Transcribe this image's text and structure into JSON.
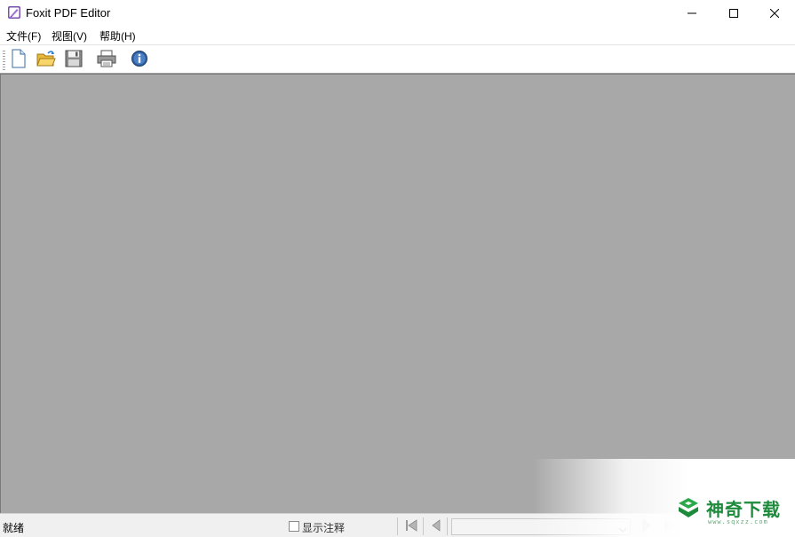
{
  "window": {
    "title": "Foxit PDF Editor",
    "icon": "foxit-pen-icon"
  },
  "menu": {
    "items": [
      {
        "label": "文件(F)"
      },
      {
        "label": "视图(V)"
      },
      {
        "label": "帮助(H)"
      }
    ]
  },
  "toolbar": {
    "buttons": [
      {
        "name": "new",
        "icon": "new-document-icon"
      },
      {
        "name": "open",
        "icon": "open-folder-icon"
      },
      {
        "name": "save",
        "icon": "save-disk-icon"
      },
      {
        "name": "print",
        "icon": "printer-icon"
      },
      {
        "name": "about",
        "icon": "info-icon"
      }
    ]
  },
  "colors": {
    "document_background": "#a8a8a8",
    "watermark_green": "#1e8a3c"
  },
  "statusbar": {
    "status_text": "就绪",
    "show_annotations_label": "显示注释",
    "show_annotations_checked": false,
    "page_select_value": ""
  },
  "watermark": {
    "text": "神奇下载",
    "url": "www.sqxzz.com"
  }
}
